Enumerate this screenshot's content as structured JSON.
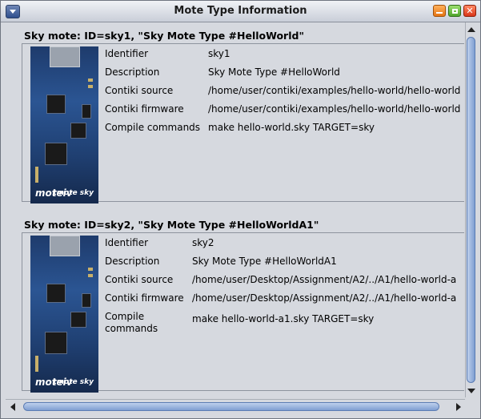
{
  "window": {
    "title": "Mote Type Information"
  },
  "motes": [
    {
      "heading": "Sky mote: ID=sky1, \"Sky Mote Type #HelloWorld\"",
      "image": {
        "logo_left": "moteiv",
        "logo_right": "tmote sky"
      },
      "fields": [
        {
          "label": "Identifier",
          "value": "sky1"
        },
        {
          "label": "Description",
          "value": "Sky Mote Type #HelloWorld"
        },
        {
          "label": "Contiki source",
          "value": "/home/user/contiki/examples/hello-world/hello-world"
        },
        {
          "label": "Contiki firmware",
          "value": "/home/user/contiki/examples/hello-world/hello-world"
        },
        {
          "label": "Compile commands",
          "value": "make hello-world.sky TARGET=sky"
        }
      ]
    },
    {
      "heading": "Sky mote: ID=sky2, \"Sky Mote Type #HelloWorldA1\"",
      "image": {
        "logo_left": "moteiv",
        "logo_right": "tmote sky"
      },
      "fields": [
        {
          "label": "Identifier",
          "value": "sky2"
        },
        {
          "label": "Description",
          "value": "Sky Mote Type #HelloWorldA1"
        },
        {
          "label": "Contiki source",
          "value": "/home/user/Desktop/Assignment/A2/../A1/hello-world-a"
        },
        {
          "label": "Contiki firmware",
          "value": "/home/user/Desktop/Assignment/A2/../A1/hello-world-a"
        },
        {
          "label": "Compile commands",
          "value": "make hello-world-a1.sky TARGET=sky"
        }
      ]
    }
  ],
  "icons": {
    "window_menu": "chevron-down-icon",
    "minimize": "minimize-icon",
    "maximize": "maximize-icon",
    "close": "close-icon"
  }
}
